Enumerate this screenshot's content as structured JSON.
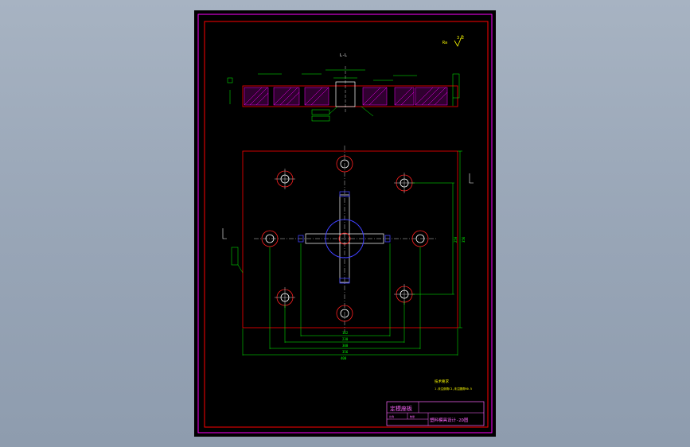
{
  "drawing": {
    "section_label": "L-L",
    "roughness_top": "Ra",
    "roughness_top_value": "3.2",
    "part_title": "定模座板",
    "drawing_code": "塑料模具设计-2D图",
    "tb_cell_1": "比例",
    "tb_cell_2": "数量",
    "note_heading": "技术要求",
    "note_line": "1.未注倒角C1,未注圆角R0.5",
    "dims_horizontal": [
      "162",
      "230",
      "300",
      "356",
      "400"
    ],
    "dim_vertical": "356",
    "dim_vertical_2": "250"
  },
  "colors": {
    "background": "#000000",
    "frame": "#ff0000",
    "outer_frame": "#ff00ff",
    "dimension": "#00ff00",
    "geometry": "#ffffff",
    "hatch": "#ff00ff",
    "circle": "#ff2020",
    "hub": "#4040ff",
    "annotation": "#ffff00",
    "title_block_text": "#ff66ff"
  }
}
